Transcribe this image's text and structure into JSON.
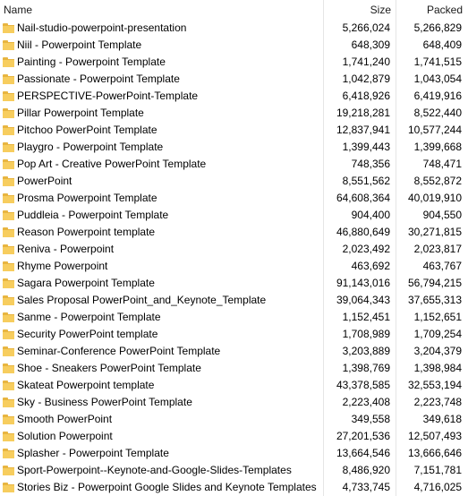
{
  "columns": {
    "name": "Name",
    "size": "Size",
    "packed": "Packed"
  },
  "colors": {
    "folder": "#f7cd5e",
    "folder_tab": "#e8b540",
    "separator": "#e5e5e5"
  },
  "rows": [
    {
      "name": "Nail-studio-powerpoint-presentation",
      "size": "5,266,024",
      "packed": "5,266,829"
    },
    {
      "name": "Niil - Powerpoint Template",
      "size": "648,309",
      "packed": "648,409"
    },
    {
      "name": "Painting - Powerpoint Template",
      "size": "1,741,240",
      "packed": "1,741,515"
    },
    {
      "name": "Passionate - Powerpoint Template",
      "size": "1,042,879",
      "packed": "1,043,054"
    },
    {
      "name": "PERSPECTIVE-PowerPoint-Template",
      "size": "6,418,926",
      "packed": "6,419,916"
    },
    {
      "name": "Pillar Powerpoint Template",
      "size": "19,218,281",
      "packed": "8,522,440"
    },
    {
      "name": "Pitchoo PowerPoint Template",
      "size": "12,837,941",
      "packed": "10,577,244"
    },
    {
      "name": "Playgro - Powerpoint Template",
      "size": "1,399,443",
      "packed": "1,399,668"
    },
    {
      "name": "Pop Art - Creative PowerPoint Template",
      "size": "748,356",
      "packed": "748,471"
    },
    {
      "name": "PowerPoint",
      "size": "8,551,562",
      "packed": "8,552,872"
    },
    {
      "name": "Prosma Powerpoint Template",
      "size": "64,608,364",
      "packed": "40,019,910"
    },
    {
      "name": "Puddleia - Powerpoint Template",
      "size": "904,400",
      "packed": "904,550"
    },
    {
      "name": "Reason Powerpoint template",
      "size": "46,880,649",
      "packed": "30,271,815"
    },
    {
      "name": "Reniva - Powerpoint",
      "size": "2,023,492",
      "packed": "2,023,817"
    },
    {
      "name": "Rhyme Powerpoint",
      "size": "463,692",
      "packed": "463,767"
    },
    {
      "name": "Sagara Powerpoint Template",
      "size": "91,143,016",
      "packed": "56,794,215"
    },
    {
      "name": "Sales Proposal PowerPoint_and_Keynote_Template",
      "size": "39,064,343",
      "packed": "37,655,313"
    },
    {
      "name": "Sanme - Powerpoint Template",
      "size": "1,152,451",
      "packed": "1,152,651"
    },
    {
      "name": "Security PowerPoint template",
      "size": "1,708,989",
      "packed": "1,709,254"
    },
    {
      "name": "Seminar-Conference PowerPoint Template",
      "size": "3,203,889",
      "packed": "3,204,379"
    },
    {
      "name": "Shoe - Sneakers PowerPoint Template",
      "size": "1,398,769",
      "packed": "1,398,984"
    },
    {
      "name": "Skateat Powerpoint template",
      "size": "43,378,585",
      "packed": "32,553,194"
    },
    {
      "name": "Sky - Business PowerPoint Template",
      "size": "2,223,408",
      "packed": "2,223,748"
    },
    {
      "name": "Smooth PowerPoint",
      "size": "349,558",
      "packed": "349,618"
    },
    {
      "name": "Solution Powerpoint",
      "size": "27,201,536",
      "packed": "12,507,493"
    },
    {
      "name": "Splasher - Powerpoint Template",
      "size": "13,664,546",
      "packed": "13,666,646"
    },
    {
      "name": "Sport-Powerpoint--Keynote-and-Google-Slides-Templates",
      "size": "8,486,920",
      "packed": "7,151,781"
    },
    {
      "name": "Stories Biz - Powerpoint Google Slides and Keynote Templates",
      "size": "4,733,745",
      "packed": "4,716,025"
    }
  ]
}
